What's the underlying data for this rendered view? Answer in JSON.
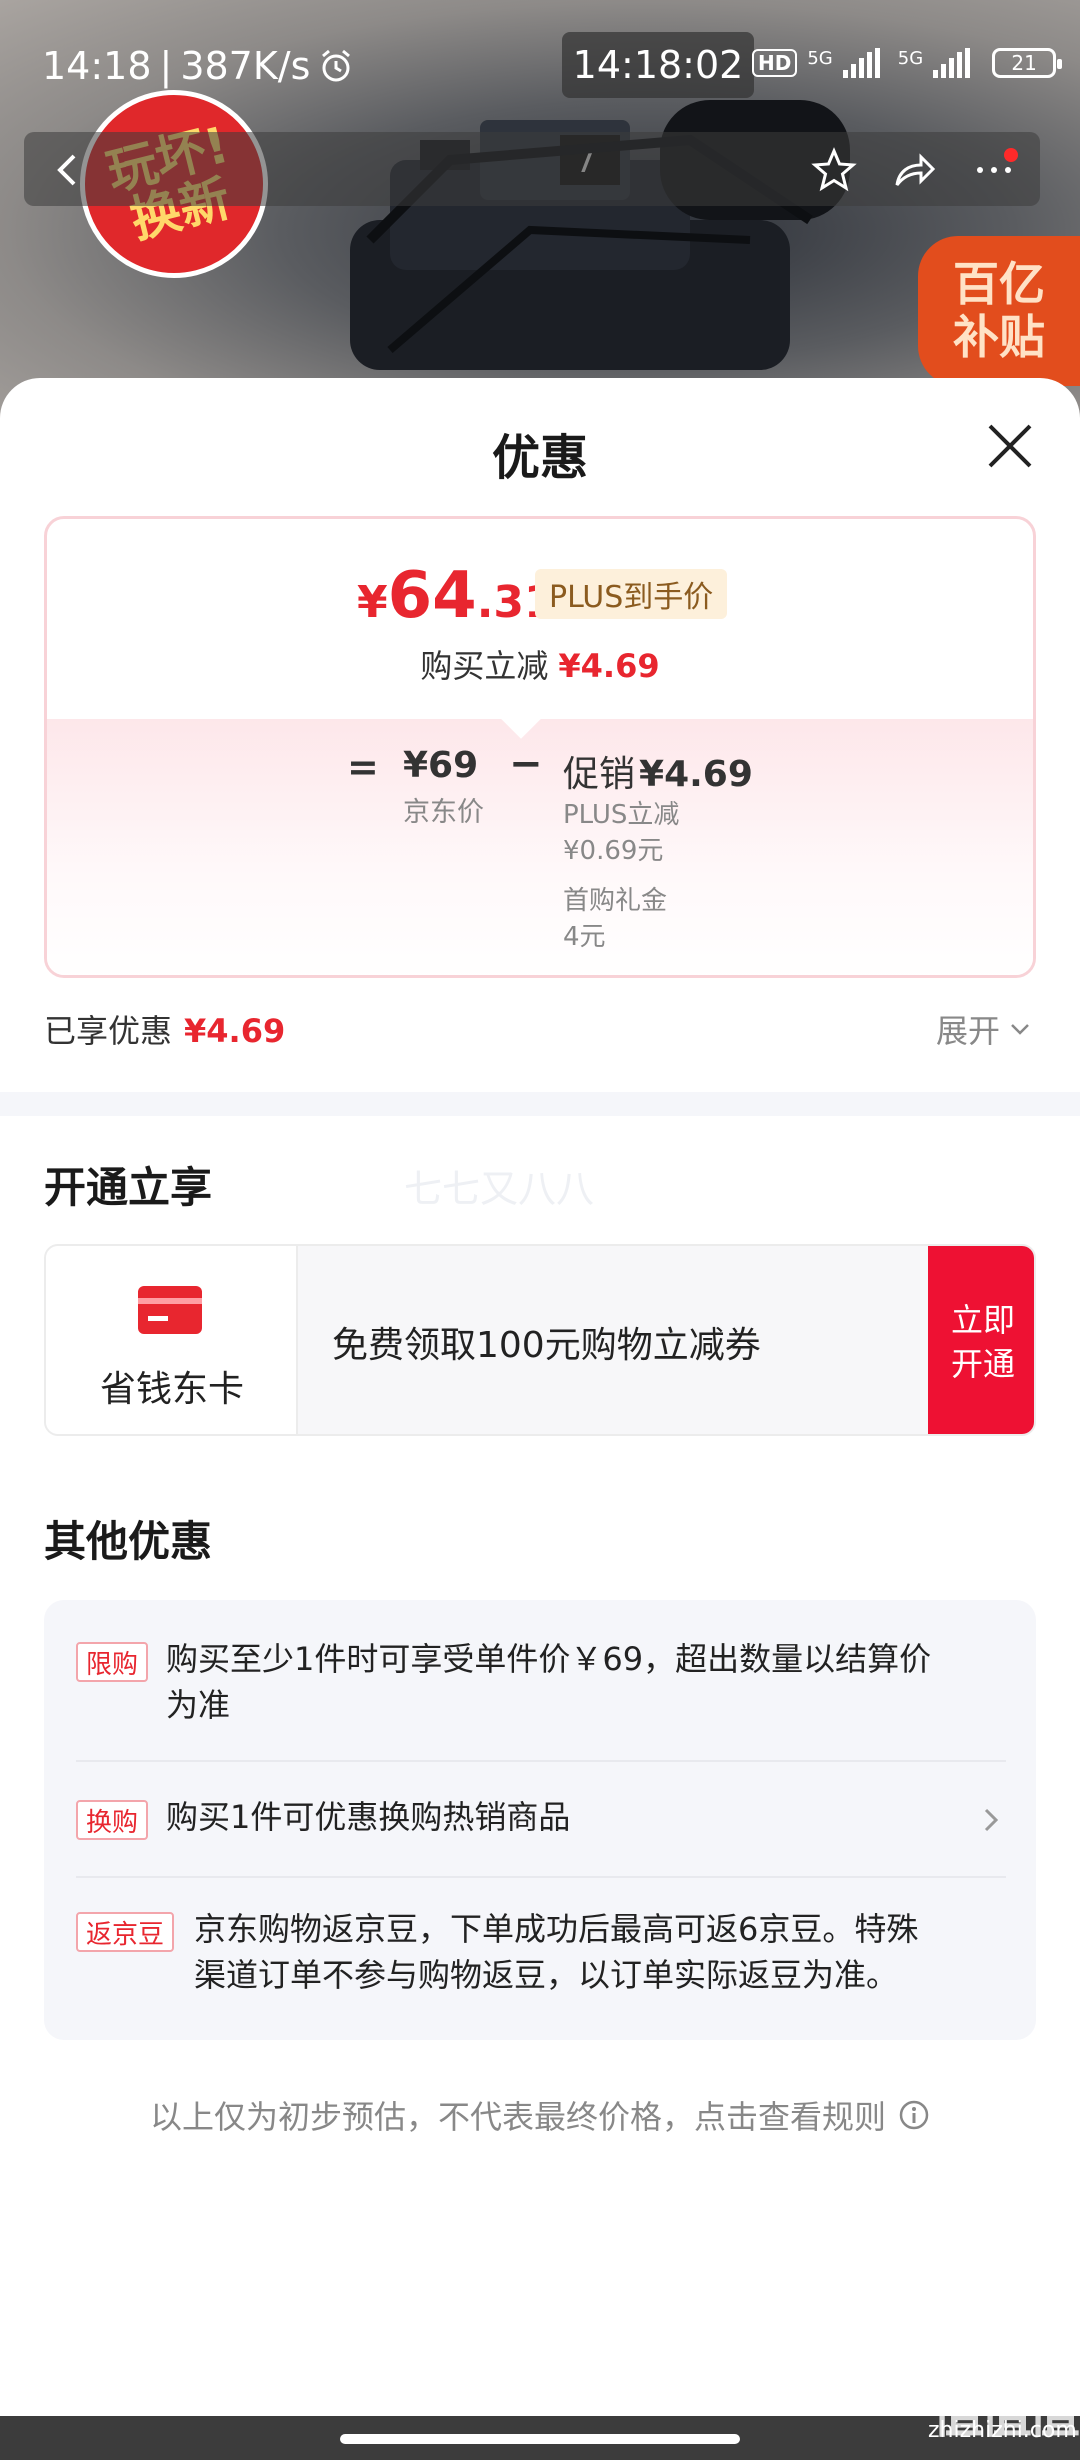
{
  "status_bar": {
    "time": "14:18",
    "speed": "387K/s",
    "clock_pill": "14:18:02",
    "network_1": "5G",
    "network_2": "5G",
    "hd_label": "HD",
    "battery": "21"
  },
  "product_image": {
    "badge_left_line1": "玩坏!",
    "badge_left_line2": "换新",
    "badge_right_line1": "百亿",
    "badge_right_line2": "补贴"
  },
  "sheet": {
    "title": "优惠"
  },
  "price_card": {
    "currency": "¥",
    "price_int": "64",
    "price_dec": ".31",
    "plus_tag": "PLUS到手价",
    "instant_label": "购买立减",
    "instant_value": "¥4.69",
    "equals": "=",
    "base_price": "¥69",
    "base_label": "京东价",
    "minus": "−",
    "promo_label": "促销",
    "promo_value": "¥4.69",
    "detail_1_label": "PLUS立减",
    "detail_1_value": "¥0.69元",
    "detail_2_label": "首购礼金",
    "detail_2_value": "4元"
  },
  "enjoyed": {
    "label": "已享优惠",
    "value": "¥4.69",
    "expand_label": "展开"
  },
  "open_section": {
    "title": "开通立享",
    "faint_text": "七七又八八",
    "card_name": "省钱东卡",
    "card_desc": "免费领取100元购物立减券",
    "button_line1": "立即",
    "button_line2": "开通"
  },
  "other_section": {
    "title": "其他优惠",
    "offers": [
      {
        "tag": "限购",
        "text_line1": "购买至少1件时可享受单件价￥69，超出数量以结算价",
        "text_line2": "为准"
      },
      {
        "tag": "换购",
        "text_line1": "购买1件可优惠换购热销商品"
      },
      {
        "tag": "返京豆",
        "text_line1": "京东购物返京豆，下单成功后最高可返6京豆。特殊",
        "text_line2": "渠道订单不参与购物返豆，以订单实际返豆为准。"
      }
    ]
  },
  "footer": {
    "note": "以上仅为初步预估，不代表最终价格，点击查看规则"
  },
  "watermark": {
    "site": "zhizhizhi.com",
    "logo": "值值值"
  },
  "colors": {
    "accent_red": "#e8262f",
    "button_red": "#ee1133",
    "plus_bg": "#fdf0db",
    "plus_text": "#8b5b1f"
  }
}
